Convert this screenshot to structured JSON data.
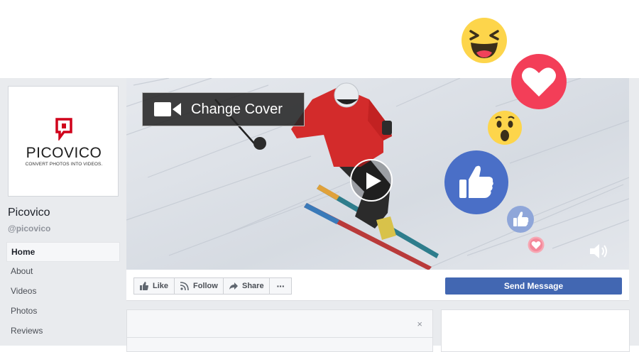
{
  "page": {
    "logo_word": "PICOVICO",
    "logo_tagline": "CONVERT PHOTOS INTO VIDEOS.",
    "name": "Picovico",
    "handle": "@picovico"
  },
  "nav": {
    "items": [
      {
        "label": "Home",
        "active": true
      },
      {
        "label": "About"
      },
      {
        "label": "Videos"
      },
      {
        "label": "Photos"
      },
      {
        "label": "Reviews"
      }
    ]
  },
  "cover": {
    "change_cover_label": "Change Cover"
  },
  "actions": {
    "like": "Like",
    "follow": "Follow",
    "share": "Share",
    "more": "···",
    "send_message": "Send Message"
  },
  "card": {
    "close": "×"
  },
  "reactions": [
    "haha-emoji",
    "love-emoji",
    "wow-emoji",
    "like-emoji",
    "like-emoji-small",
    "love-emoji-small"
  ],
  "colors": {
    "facebook_blue": "#4267b2",
    "like_blue": "#4a6fc7",
    "love_red": "#f33e58",
    "emoji_yellow": "#fdd54b",
    "picovico_red": "#d0021b"
  }
}
